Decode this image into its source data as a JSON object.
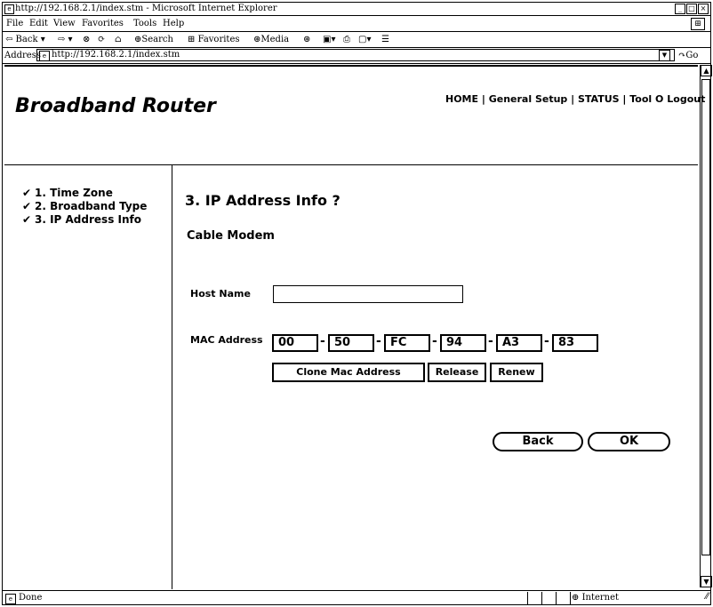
{
  "window": {
    "title": "http://192.168.2.1/index.stm - Microsoft Internet Explorer",
    "controls": [
      "_",
      "□",
      "×"
    ]
  },
  "menu": [
    "File",
    "Edit",
    "View",
    "Favorites",
    "Tools",
    "Help"
  ],
  "toolbar": {
    "back": "⇦ Back ▾",
    "forward": "⇨ ▾",
    "stop": "⊗",
    "refresh": "⟳",
    "home": "⌂",
    "search": "Search",
    "favorites": "Favorites",
    "media": "Media",
    "history": "⊛",
    "mail": "▣▾",
    "print": "⎙",
    "edit": "▢▾",
    "discuss": "☰"
  },
  "address": {
    "label": "Address",
    "url": "http://192.168.2.1/index.stm",
    "go": "Go"
  },
  "page": {
    "brand": "Broadband Router",
    "nav": [
      "HOME",
      "General Setup",
      "STATUS",
      "Tool",
      "Logout"
    ],
    "steps": [
      "1. Time Zone",
      "2. Broadband Type",
      "3. IP Address Info"
    ],
    "title": "3. IP Address Info ?",
    "subtitle": "Cable Modem",
    "host_name_label": "Host Name",
    "host_name_value": "",
    "mac_label": "MAC Address",
    "mac": [
      "00",
      "50",
      "FC",
      "94",
      "A3",
      "83"
    ],
    "clone_button": "Clone Mac Address",
    "release_button": "Release",
    "renew_button": "Renew",
    "back_button": "Back",
    "ok_button": "OK"
  },
  "status": {
    "text": "Done",
    "zone": "Internet"
  }
}
